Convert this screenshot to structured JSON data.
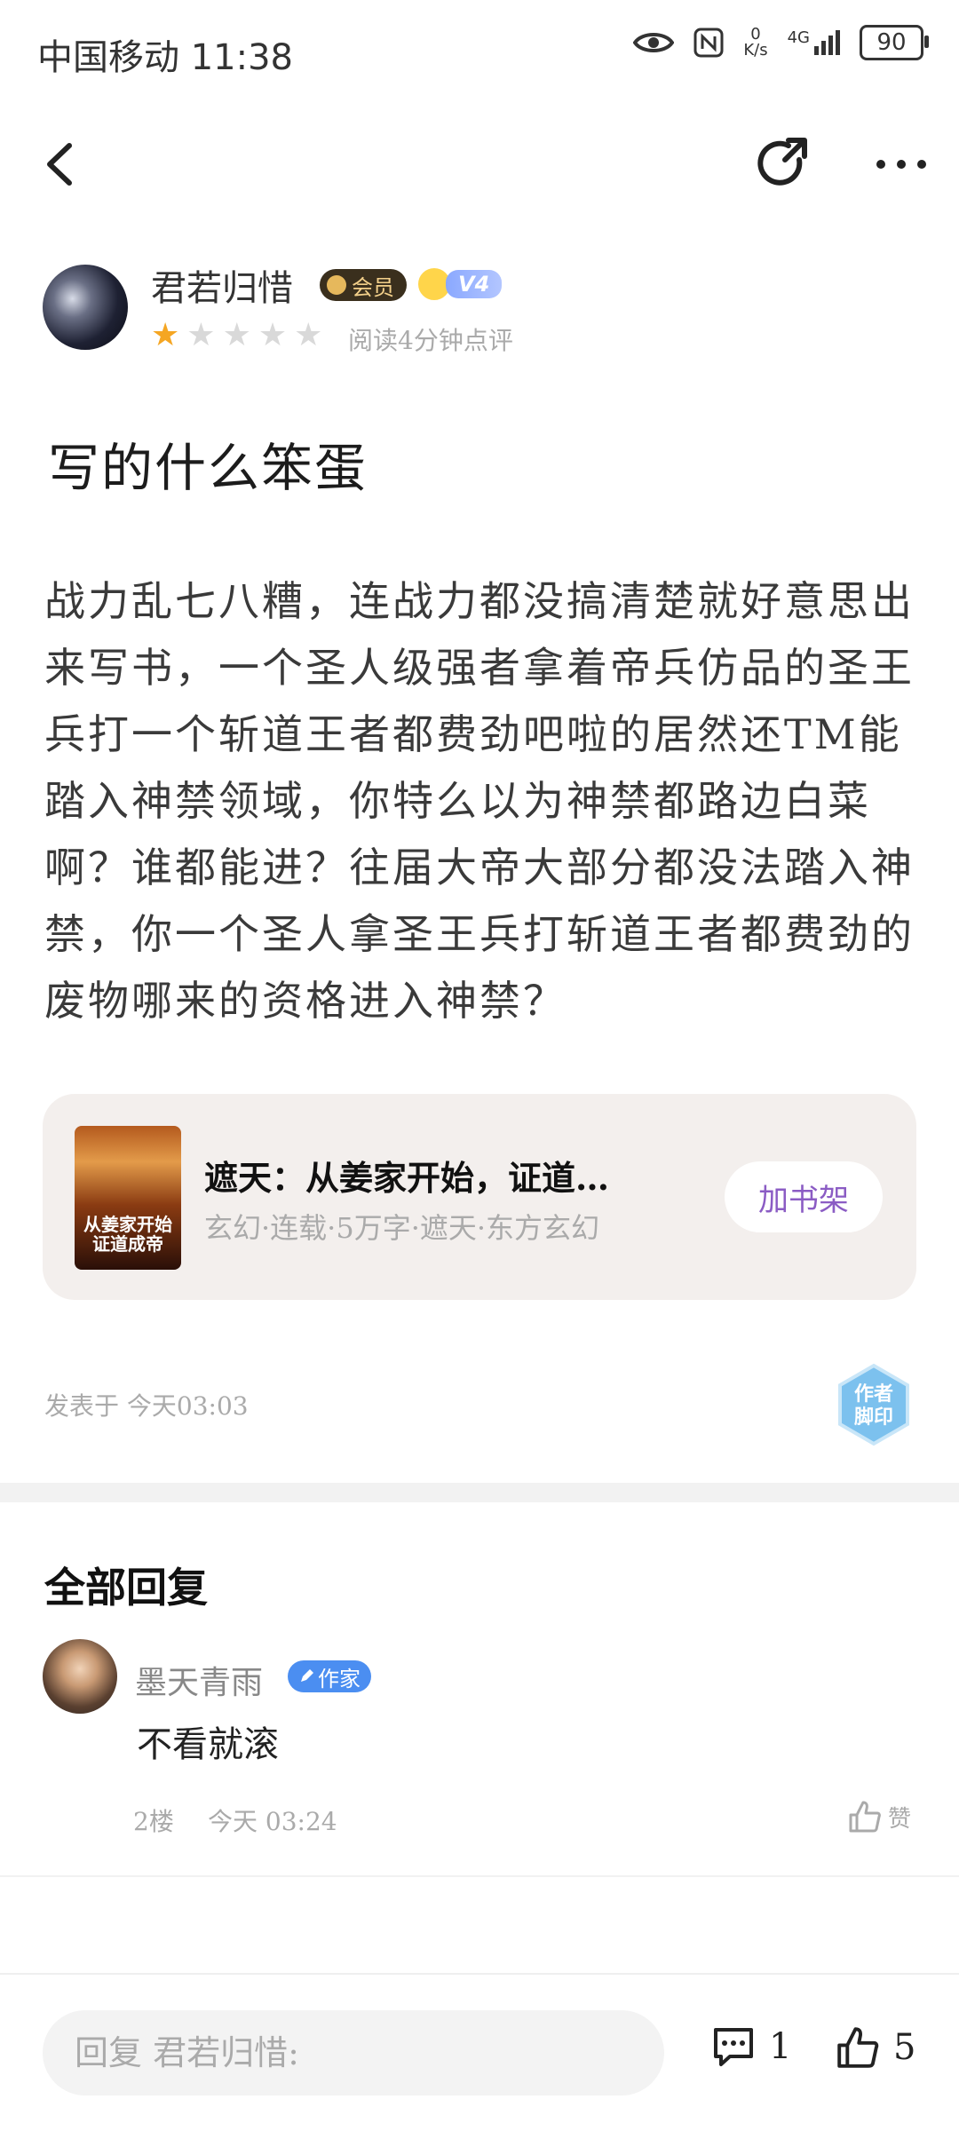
{
  "status_bar": {
    "carrier_time": "中国移动 11:38",
    "net_speed_value": "0",
    "net_speed_unit": "K/s",
    "network": "4G",
    "battery": "90"
  },
  "author": {
    "name": "君若归惜",
    "member_badge": "会员",
    "level_badge": "V4",
    "rating": 1,
    "rating_max": 5,
    "read_note": "阅读4分钟点评"
  },
  "post": {
    "title": "写的什么笨蛋",
    "body": "战力乱七八糟，连战力都没搞清楚就好意思出来写书，一个圣人级强者拿着帝兵仿品的圣王兵打一个斩道王者都费劲吧啦的居然还TM能踏入神禁领域，你特么以为神禁都路边白菜啊？谁都能进？往届大帝大部分都没法踏入神禁，你一个圣人拿圣王兵打斩道王者都费劲的废物哪来的资格进入神禁？",
    "time": "发表于 今天03:03",
    "stamp_text": "作者脚印"
  },
  "book": {
    "cover_text": "从姜家开始证道成帝",
    "title": "遮天：从姜家开始，证道…",
    "meta": "玄幻·连载·5万字·遮天·东方玄幻",
    "add_button": "加书架"
  },
  "replies": {
    "heading": "全部回复",
    "items": [
      {
        "user": "墨天青雨",
        "badge": "作家",
        "text": "不看就滚",
        "floor": "2楼",
        "time": "今天 03:24",
        "like_label": "赞"
      }
    ]
  },
  "bottom_bar": {
    "reply_placeholder": "回复 君若归惜:",
    "comment_count": "1",
    "like_count": "5"
  }
}
